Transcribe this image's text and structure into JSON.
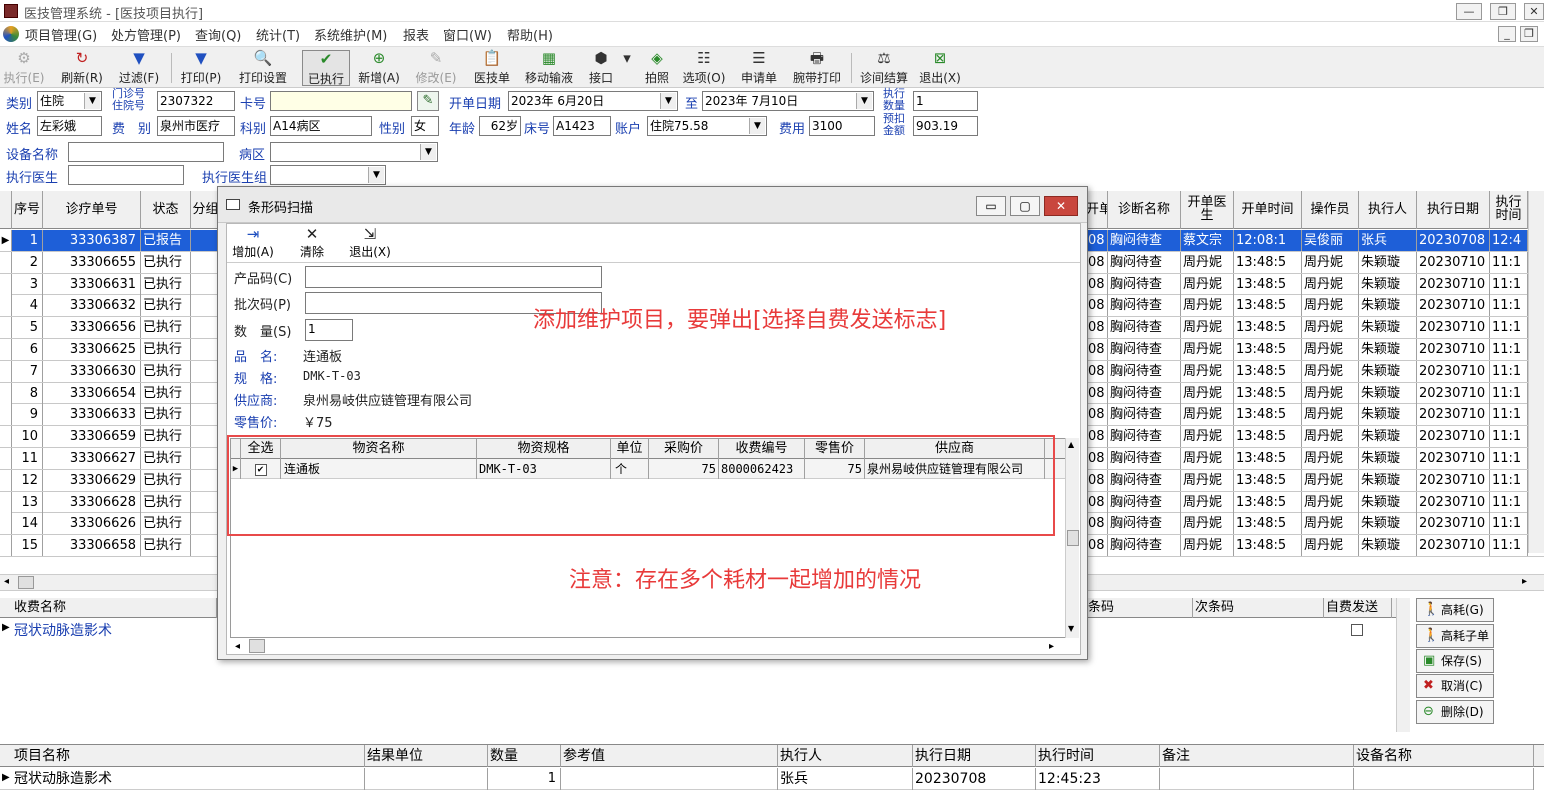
{
  "window": {
    "title": "医技管理系统 - [医技项目执行]"
  },
  "menu": [
    "项目管理(G)",
    "处方管理(P)",
    "查询(Q)",
    "统计(T)",
    "系统维护(M)",
    "报表",
    "窗口(W)",
    "帮助(H)"
  ],
  "toolbar": [
    {
      "label": "执行(E)",
      "icon": "execute-icon",
      "disabled": true
    },
    {
      "label": "刷新(R)",
      "icon": "refresh-icon",
      "disabled": false
    },
    {
      "label": "过滤(F)",
      "icon": "filter-icon",
      "disabled": false
    },
    {
      "label": "打印(P)",
      "icon": "print-filter-icon",
      "disabled": false
    },
    {
      "label": "打印设置",
      "icon": "print-setup-icon",
      "disabled": false
    },
    {
      "label": "已执行",
      "icon": "executed-icon",
      "disabled": false,
      "pressed": true
    },
    {
      "label": "新增(A)",
      "icon": "add-icon",
      "disabled": false
    },
    {
      "label": "修改(E)",
      "icon": "edit-icon",
      "disabled": true
    },
    {
      "label": "医技单",
      "icon": "document-icon",
      "disabled": false
    },
    {
      "label": "移动输液",
      "icon": "mobile-infusion-icon",
      "disabled": false
    },
    {
      "label": "接口",
      "icon": "interface-icon",
      "disabled": false
    },
    {
      "label": "拍照",
      "icon": "camera-icon",
      "disabled": false
    },
    {
      "label": "选项(O)",
      "icon": "options-icon",
      "disabled": false
    },
    {
      "label": "申请单",
      "icon": "request-form-icon",
      "disabled": false
    },
    {
      "label": "腕带打印",
      "icon": "wristband-print-icon",
      "disabled": false
    },
    {
      "label": "诊间结算",
      "icon": "settlement-icon",
      "disabled": false
    },
    {
      "label": "退出(X)",
      "icon": "exit-icon",
      "disabled": false
    }
  ],
  "filters": {
    "category_label": "类别",
    "category_value": "住院",
    "clinic_no_label_1": "门诊号",
    "clinic_no_label_2": "住院号",
    "clinic_no_value": "2307322",
    "card_label": "卡号",
    "card_value": "",
    "start_date_label": "开单日期",
    "start_date_value": "2023年 6月20日",
    "to_label": "至",
    "end_date_value": "2023年 7月10日",
    "exec_count_label_1": "执行",
    "exec_count_label_2": "数量",
    "exec_count_value": "1",
    "name_label": "姓名",
    "name_value": "左彩娥",
    "fee_label": "费　别",
    "fee_value": "泉州市医疗",
    "dept_label": "科别",
    "dept_value": "A14病区",
    "sex_label": "性别",
    "sex_value": "女",
    "age_label": "年龄",
    "age_value": "62岁",
    "bed_label": "床号",
    "bed_value": "A1423",
    "account_label": "账户",
    "account_value": "住院75.58",
    "cost_label": "费用",
    "cost_value": "3100",
    "prededuct_label_1": "预扣",
    "prededuct_label_2": "金额",
    "prededuct_value": "903.19",
    "device_label": "设备名称",
    "device_value": "",
    "ward_label": "病区",
    "ward_value": "",
    "doctor_label": "执行医生",
    "doctor_value": "",
    "doctor_group_label": "执行医生组",
    "doctor_group_value": ""
  },
  "main_grid": {
    "left_headers": [
      "序号",
      "诊疗单号",
      "状态",
      "分组"
    ],
    "right_headers": [
      "开单日期",
      "诊断名称",
      "开单医生",
      "开单时间",
      "操作员",
      "执行人",
      "执行日期",
      "执行时间"
    ],
    "rows": [
      {
        "seq": "1",
        "order": "33306387",
        "status": "已报告",
        "date": "08",
        "diag": "胸闷待查",
        "doctor": "蔡文宗",
        "time": "12:08:1",
        "op": "吴俊丽",
        "exec": "张兵",
        "exec_date": "20230708",
        "exec_time": "12:4"
      },
      {
        "seq": "2",
        "order": "33306655",
        "status": "已执行",
        "date": "08",
        "diag": "胸闷待查",
        "doctor": "周丹妮",
        "time": "13:48:5",
        "op": "周丹妮",
        "exec": "朱颖璇",
        "exec_date": "20230710",
        "exec_time": "11:1"
      },
      {
        "seq": "3",
        "order": "33306631",
        "status": "已执行",
        "date": "08",
        "diag": "胸闷待查",
        "doctor": "周丹妮",
        "time": "13:48:5",
        "op": "周丹妮",
        "exec": "朱颖璇",
        "exec_date": "20230710",
        "exec_time": "11:1"
      },
      {
        "seq": "4",
        "order": "33306632",
        "status": "已执行",
        "date": "08",
        "diag": "胸闷待查",
        "doctor": "周丹妮",
        "time": "13:48:5",
        "op": "周丹妮",
        "exec": "朱颖璇",
        "exec_date": "20230710",
        "exec_time": "11:1"
      },
      {
        "seq": "5",
        "order": "33306656",
        "status": "已执行",
        "date": "08",
        "diag": "胸闷待查",
        "doctor": "周丹妮",
        "time": "13:48:5",
        "op": "周丹妮",
        "exec": "朱颖璇",
        "exec_date": "20230710",
        "exec_time": "11:1"
      },
      {
        "seq": "6",
        "order": "33306625",
        "status": "已执行",
        "date": "08",
        "diag": "胸闷待查",
        "doctor": "周丹妮",
        "time": "13:48:5",
        "op": "周丹妮",
        "exec": "朱颖璇",
        "exec_date": "20230710",
        "exec_time": "11:1"
      },
      {
        "seq": "7",
        "order": "33306630",
        "status": "已执行",
        "date": "08",
        "diag": "胸闷待查",
        "doctor": "周丹妮",
        "time": "13:48:5",
        "op": "周丹妮",
        "exec": "朱颖璇",
        "exec_date": "20230710",
        "exec_time": "11:1"
      },
      {
        "seq": "8",
        "order": "33306654",
        "status": "已执行",
        "date": "08",
        "diag": "胸闷待查",
        "doctor": "周丹妮",
        "time": "13:48:5",
        "op": "周丹妮",
        "exec": "朱颖璇",
        "exec_date": "20230710",
        "exec_time": "11:1"
      },
      {
        "seq": "9",
        "order": "33306633",
        "status": "已执行",
        "date": "08",
        "diag": "胸闷待查",
        "doctor": "周丹妮",
        "time": "13:48:5",
        "op": "周丹妮",
        "exec": "朱颖璇",
        "exec_date": "20230710",
        "exec_time": "11:1"
      },
      {
        "seq": "10",
        "order": "33306659",
        "status": "已执行",
        "date": "08",
        "diag": "胸闷待查",
        "doctor": "周丹妮",
        "time": "13:48:5",
        "op": "周丹妮",
        "exec": "朱颖璇",
        "exec_date": "20230710",
        "exec_time": "11:1"
      },
      {
        "seq": "11",
        "order": "33306627",
        "status": "已执行",
        "date": "08",
        "diag": "胸闷待查",
        "doctor": "周丹妮",
        "time": "13:48:5",
        "op": "周丹妮",
        "exec": "朱颖璇",
        "exec_date": "20230710",
        "exec_time": "11:1"
      },
      {
        "seq": "12",
        "order": "33306629",
        "status": "已执行",
        "date": "08",
        "diag": "胸闷待查",
        "doctor": "周丹妮",
        "time": "13:48:5",
        "op": "周丹妮",
        "exec": "朱颖璇",
        "exec_date": "20230710",
        "exec_time": "11:1"
      },
      {
        "seq": "13",
        "order": "33306628",
        "status": "已执行",
        "date": "08",
        "diag": "胸闷待查",
        "doctor": "周丹妮",
        "time": "13:48:5",
        "op": "周丹妮",
        "exec": "朱颖璇",
        "exec_date": "20230710",
        "exec_time": "11:1"
      },
      {
        "seq": "14",
        "order": "33306626",
        "status": "已执行",
        "date": "08",
        "diag": "胸闷待查",
        "doctor": "周丹妮",
        "time": "13:48:5",
        "op": "周丹妮",
        "exec": "朱颖璇",
        "exec_date": "20230710",
        "exec_time": "11:1"
      },
      {
        "seq": "15",
        "order": "33306658",
        "status": "已执行",
        "date": "08",
        "diag": "胸闷待查",
        "doctor": "周丹妮",
        "time": "13:48:5",
        "op": "周丹妮",
        "exec": "朱颖璇",
        "exec_date": "20230710",
        "exec_time": "11:1"
      }
    ]
  },
  "fee_panel": {
    "headers": [
      "收费名称",
      "条码",
      "次条码",
      "自费发送"
    ],
    "row_name": "冠状动脉造影术"
  },
  "side_buttons": [
    {
      "label": "高耗(G)",
      "icon": "person-icon"
    },
    {
      "label": "高耗子单",
      "icon": "person-icon"
    },
    {
      "label": "保存(S)",
      "icon": "save-icon"
    },
    {
      "label": "取消(C)",
      "icon": "cancel-icon"
    },
    {
      "label": "删除(D)",
      "icon": "delete-icon"
    }
  ],
  "result_panel": {
    "headers": [
      "项目名称",
      "结果单位",
      "数量",
      "参考值",
      "执行人",
      "执行日期",
      "执行时间",
      "备注",
      "设备名称"
    ],
    "row": [
      "冠状动脉造影术",
      "",
      "1",
      "",
      "张兵",
      "20230708",
      "12:45:23",
      "",
      ""
    ]
  },
  "dialog": {
    "title": "条形码扫描",
    "toolbar": [
      {
        "label": "增加(A)",
        "icon": "add-row-icon"
      },
      {
        "label": "清除",
        "icon": "clear-icon"
      },
      {
        "label": "退出(X)",
        "icon": "exit-icon"
      }
    ],
    "product_code_label": "产品码(C)",
    "product_code_value": "",
    "batch_code_label": "批次码(P)",
    "batch_code_value": "",
    "qty_label": "数　量(S)",
    "qty_value": "1",
    "name_label": "品　名:",
    "name_value": "连通板",
    "spec_label": "规　格:",
    "spec_value": "DMK-T-03",
    "supplier_label": "供应商:",
    "supplier_value": "泉州易岐供应链管理有限公司",
    "price_label": "零售价:",
    "price_value": "￥75",
    "grid_headers": [
      "全选",
      "物资名称",
      "物资规格",
      "单位",
      "采购价",
      "收费编号",
      "零售价",
      "供应商"
    ],
    "grid_row": {
      "name": "连通板",
      "spec": "DMK-T-03",
      "unit": "个",
      "purchase": "75",
      "fee_code": "8000062423",
      "retail": "75",
      "supplier": "泉州易岐供应链管理有限公司"
    }
  },
  "annotations": {
    "note1": "添加维护项目，要弹出[选择自费发送标志]",
    "note2": "注意：存在多个耗材一起增加的情况"
  },
  "colors": {
    "selection": "#1e5fd8",
    "label_blue": "#1a3fb0",
    "annotation_red": "#e83a3a"
  }
}
